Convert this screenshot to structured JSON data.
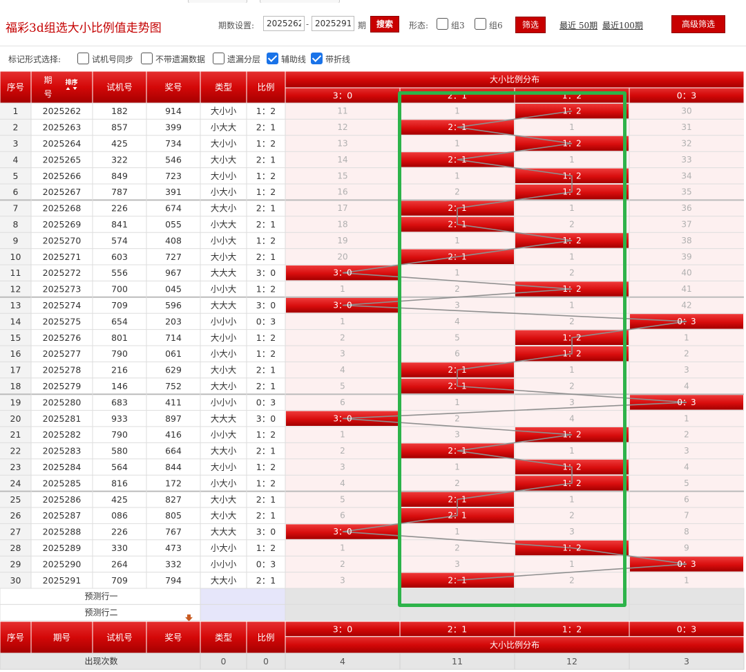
{
  "header": {
    "title": "福彩3d组选大小比例值走势图",
    "period_label": "期数设置:",
    "period_from": "2025262",
    "period_sep": "-",
    "period_to": "2025291",
    "period_unit": "期",
    "search_label": "搜索",
    "shape_label": "形态:",
    "group3_label": "组3",
    "group6_label": "组6",
    "filter_label": "筛选",
    "recent50_label": "最近 50期",
    "recent100_label": "最近100期",
    "advanced_label": "高级筛选"
  },
  "marks": {
    "label": "标记形式选择:",
    "options": [
      {
        "label": "试机号同步",
        "checked": false
      },
      {
        "label": "不带遗漏数据",
        "checked": false
      },
      {
        "label": "遗漏分层",
        "checked": false
      },
      {
        "label": "辅助线",
        "checked": true
      },
      {
        "label": "带折线",
        "checked": true
      }
    ]
  },
  "table": {
    "headers": {
      "index": "序号",
      "period": "期号",
      "sort": "排序",
      "trial": "试机号",
      "prize": "奖号",
      "type": "类型",
      "ratio": "比例",
      "dist": "大小比例分布"
    },
    "ratio_columns": [
      "3：0",
      "2：1",
      "1：2",
      "0：3"
    ],
    "rows": [
      {
        "idx": "1",
        "period": "2025262",
        "trial": "182",
        "prize": "914",
        "type": "大小小",
        "ratio": "1：2",
        "cells": [
          "11",
          "1",
          "1：2",
          "30"
        ],
        "hit": 2
      },
      {
        "idx": "2",
        "period": "2025263",
        "trial": "857",
        "prize": "399",
        "type": "小大大",
        "ratio": "2：1",
        "cells": [
          "12",
          "2：1",
          "1",
          "31"
        ],
        "hit": 1
      },
      {
        "idx": "3",
        "period": "2025264",
        "trial": "425",
        "prize": "734",
        "type": "大小小",
        "ratio": "1：2",
        "cells": [
          "13",
          "1",
          "1：2",
          "32"
        ],
        "hit": 2
      },
      {
        "idx": "4",
        "period": "2025265",
        "trial": "322",
        "prize": "546",
        "type": "大小大",
        "ratio": "2：1",
        "cells": [
          "14",
          "2：1",
          "1",
          "33"
        ],
        "hit": 1
      },
      {
        "idx": "5",
        "period": "2025266",
        "trial": "849",
        "prize": "723",
        "type": "大小小",
        "ratio": "1：2",
        "cells": [
          "15",
          "1",
          "1：2",
          "34"
        ],
        "hit": 2
      },
      {
        "idx": "6",
        "period": "2025267",
        "trial": "787",
        "prize": "391",
        "type": "小大小",
        "ratio": "1：2",
        "cells": [
          "16",
          "2",
          "1：2",
          "35"
        ],
        "hit": 2
      },
      {
        "idx": "7",
        "period": "2025268",
        "trial": "226",
        "prize": "674",
        "type": "大大小",
        "ratio": "2：1",
        "cells": [
          "17",
          "2：1",
          "1",
          "36"
        ],
        "hit": 1
      },
      {
        "idx": "8",
        "period": "2025269",
        "trial": "841",
        "prize": "055",
        "type": "小大大",
        "ratio": "2：1",
        "cells": [
          "18",
          "2：1",
          "2",
          "37"
        ],
        "hit": 1
      },
      {
        "idx": "9",
        "period": "2025270",
        "trial": "574",
        "prize": "408",
        "type": "小小大",
        "ratio": "1：2",
        "cells": [
          "19",
          "1",
          "1：2",
          "38"
        ],
        "hit": 2
      },
      {
        "idx": "10",
        "period": "2025271",
        "trial": "603",
        "prize": "727",
        "type": "大小大",
        "ratio": "2：1",
        "cells": [
          "20",
          "2：1",
          "1",
          "39"
        ],
        "hit": 1
      },
      {
        "idx": "11",
        "period": "2025272",
        "trial": "556",
        "prize": "967",
        "type": "大大大",
        "ratio": "3：0",
        "cells": [
          "3：0",
          "1",
          "2",
          "40"
        ],
        "hit": 0
      },
      {
        "idx": "12",
        "period": "2025273",
        "trial": "700",
        "prize": "045",
        "type": "小小大",
        "ratio": "1：2",
        "cells": [
          "1",
          "2",
          "1：2",
          "41"
        ],
        "hit": 2
      },
      {
        "idx": "13",
        "period": "2025274",
        "trial": "709",
        "prize": "596",
        "type": "大大大",
        "ratio": "3：0",
        "cells": [
          "3：0",
          "3",
          "1",
          "42"
        ],
        "hit": 0
      },
      {
        "idx": "14",
        "period": "2025275",
        "trial": "654",
        "prize": "203",
        "type": "小小小",
        "ratio": "0：3",
        "cells": [
          "1",
          "4",
          "2",
          "0：3"
        ],
        "hit": 3
      },
      {
        "idx": "15",
        "period": "2025276",
        "trial": "801",
        "prize": "714",
        "type": "大小小",
        "ratio": "1：2",
        "cells": [
          "2",
          "5",
          "1：2",
          "1"
        ],
        "hit": 2
      },
      {
        "idx": "16",
        "period": "2025277",
        "trial": "790",
        "prize": "061",
        "type": "小大小",
        "ratio": "1：2",
        "cells": [
          "3",
          "6",
          "1：2",
          "2"
        ],
        "hit": 2
      },
      {
        "idx": "17",
        "period": "2025278",
        "trial": "216",
        "prize": "629",
        "type": "大小大",
        "ratio": "2：1",
        "cells": [
          "4",
          "2：1",
          "1",
          "3"
        ],
        "hit": 1
      },
      {
        "idx": "18",
        "period": "2025279",
        "trial": "146",
        "prize": "752",
        "type": "大大小",
        "ratio": "2：1",
        "cells": [
          "5",
          "2：1",
          "2",
          "4"
        ],
        "hit": 1
      },
      {
        "idx": "19",
        "period": "2025280",
        "trial": "683",
        "prize": "411",
        "type": "小小小",
        "ratio": "0：3",
        "cells": [
          "6",
          "1",
          "3",
          "0：3"
        ],
        "hit": 3
      },
      {
        "idx": "20",
        "period": "2025281",
        "trial": "933",
        "prize": "897",
        "type": "大大大",
        "ratio": "3：0",
        "cells": [
          "3：0",
          "2",
          "4",
          "1"
        ],
        "hit": 0
      },
      {
        "idx": "21",
        "period": "2025282",
        "trial": "790",
        "prize": "416",
        "type": "小小大",
        "ratio": "1：2",
        "cells": [
          "1",
          "3",
          "1：2",
          "2"
        ],
        "hit": 2
      },
      {
        "idx": "22",
        "period": "2025283",
        "trial": "580",
        "prize": "664",
        "type": "大大小",
        "ratio": "2：1",
        "cells": [
          "2",
          "2：1",
          "1",
          "3"
        ],
        "hit": 1
      },
      {
        "idx": "23",
        "period": "2025284",
        "trial": "564",
        "prize": "844",
        "type": "大小小",
        "ratio": "1：2",
        "cells": [
          "3",
          "1",
          "1：2",
          "4"
        ],
        "hit": 2
      },
      {
        "idx": "24",
        "period": "2025285",
        "trial": "816",
        "prize": "172",
        "type": "小大小",
        "ratio": "1：2",
        "cells": [
          "4",
          "2",
          "1：2",
          "5"
        ],
        "hit": 2
      },
      {
        "idx": "25",
        "period": "2025286",
        "trial": "425",
        "prize": "827",
        "type": "大小大",
        "ratio": "2：1",
        "cells": [
          "5",
          "2：1",
          "1",
          "6"
        ],
        "hit": 1
      },
      {
        "idx": "26",
        "period": "2025287",
        "trial": "086",
        "prize": "805",
        "type": "大小大",
        "ratio": "2：1",
        "cells": [
          "6",
          "2：1",
          "2",
          "7"
        ],
        "hit": 1
      },
      {
        "idx": "27",
        "period": "2025288",
        "trial": "226",
        "prize": "767",
        "type": "大大大",
        "ratio": "3：0",
        "cells": [
          "3：0",
          "1",
          "3",
          "8"
        ],
        "hit": 0
      },
      {
        "idx": "28",
        "period": "2025289",
        "trial": "330",
        "prize": "473",
        "type": "小大小",
        "ratio": "1：2",
        "cells": [
          "1",
          "2",
          "1：2",
          "9"
        ],
        "hit": 2
      },
      {
        "idx": "29",
        "period": "2025290",
        "trial": "264",
        "prize": "332",
        "type": "小小小",
        "ratio": "0：3",
        "cells": [
          "2",
          "3",
          "1",
          "0：3"
        ],
        "hit": 3
      },
      {
        "idx": "30",
        "period": "2025291",
        "trial": "709",
        "prize": "794",
        "type": "大大小",
        "ratio": "2：1",
        "cells": [
          "3",
          "2：1",
          "2",
          "1"
        ],
        "hit": 1
      }
    ],
    "predict_rows": [
      "预测行一",
      "预测行二"
    ],
    "footer": {
      "count_label": "出现次数",
      "type_count": "0",
      "ratio_count": "0",
      "col_counts": [
        "4",
        "11",
        "12",
        "3"
      ]
    }
  },
  "colors": {
    "accent_red": "#c40000",
    "hit_red": "#d80d0d",
    "row_pink": "#fdf0f0",
    "highlight_green": "#2db34a",
    "check_blue": "#1a73e8"
  }
}
